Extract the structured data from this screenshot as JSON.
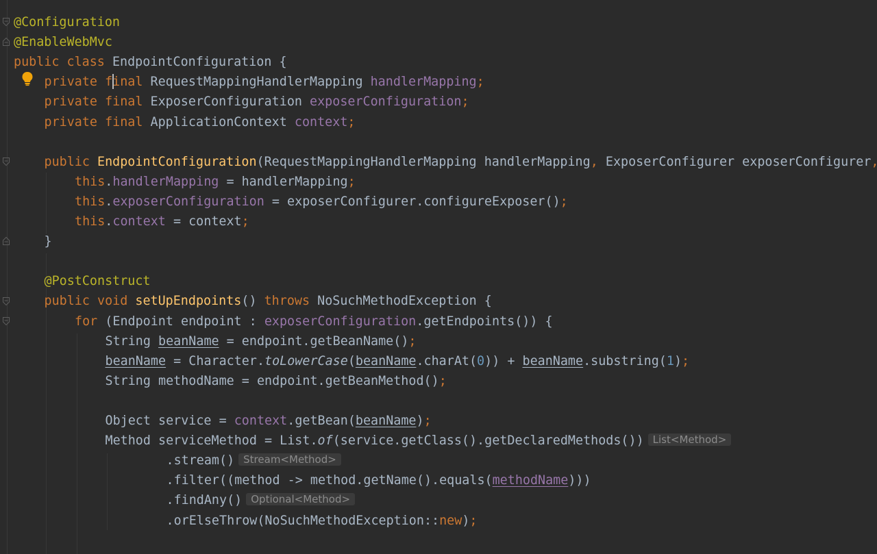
{
  "editor": {
    "lines": [
      {
        "indent": 0,
        "tokens": [
          {
            "t": "@Configuration",
            "c": "ann"
          }
        ]
      },
      {
        "indent": 0,
        "tokens": [
          {
            "t": "@EnableWebMvc",
            "c": "ann"
          }
        ]
      },
      {
        "indent": 0,
        "tokens": [
          {
            "t": "public class ",
            "c": "kw"
          },
          {
            "t": "EndpointConfiguration {",
            "c": "txt"
          }
        ]
      },
      {
        "indent": 1,
        "tokens": [
          {
            "t": "private final ",
            "c": "kw"
          },
          {
            "t": "RequestMappingHandlerMapping ",
            "c": "txt"
          },
          {
            "t": "handlerMapping",
            "c": "fld"
          },
          {
            "t": ";",
            "c": "kw"
          }
        ]
      },
      {
        "indent": 1,
        "tokens": [
          {
            "t": "private final ",
            "c": "kw"
          },
          {
            "t": "ExposerConfiguration ",
            "c": "txt"
          },
          {
            "t": "exposerConfiguration",
            "c": "fld"
          },
          {
            "t": ";",
            "c": "kw"
          }
        ]
      },
      {
        "indent": 1,
        "tokens": [
          {
            "t": "private final ",
            "c": "kw"
          },
          {
            "t": "ApplicationContext ",
            "c": "txt"
          },
          {
            "t": "context",
            "c": "fld"
          },
          {
            "t": ";",
            "c": "kw"
          }
        ]
      },
      {
        "indent": 0,
        "tokens": []
      },
      {
        "indent": 1,
        "tokens": [
          {
            "t": "public ",
            "c": "kw"
          },
          {
            "t": "EndpointConfiguration",
            "c": "fn"
          },
          {
            "t": "(RequestMappingHandlerMapping handlerMapping",
            "c": "txt"
          },
          {
            "t": ", ",
            "c": "kw"
          },
          {
            "t": "ExposerConfigurer exposerConfigurer",
            "c": "txt"
          },
          {
            "t": ",",
            "c": "kw"
          }
        ]
      },
      {
        "indent": 2,
        "tokens": [
          {
            "t": "this",
            "c": "kw"
          },
          {
            "t": ".",
            "c": "txt"
          },
          {
            "t": "handlerMapping",
            "c": "fld"
          },
          {
            "t": " = handlerMapping",
            "c": "txt"
          },
          {
            "t": ";",
            "c": "kw"
          }
        ]
      },
      {
        "indent": 2,
        "tokens": [
          {
            "t": "this",
            "c": "kw"
          },
          {
            "t": ".",
            "c": "txt"
          },
          {
            "t": "exposerConfiguration",
            "c": "fld"
          },
          {
            "t": " = exposerConfigurer.configureExposer()",
            "c": "txt"
          },
          {
            "t": ";",
            "c": "kw"
          }
        ]
      },
      {
        "indent": 2,
        "tokens": [
          {
            "t": "this",
            "c": "kw"
          },
          {
            "t": ".",
            "c": "txt"
          },
          {
            "t": "context",
            "c": "fld"
          },
          {
            "t": " = context",
            "c": "txt"
          },
          {
            "t": ";",
            "c": "kw"
          }
        ]
      },
      {
        "indent": 1,
        "tokens": [
          {
            "t": "}",
            "c": "txt"
          }
        ]
      },
      {
        "indent": 0,
        "tokens": []
      },
      {
        "indent": 1,
        "tokens": [
          {
            "t": "@PostConstruct",
            "c": "ann"
          }
        ]
      },
      {
        "indent": 1,
        "tokens": [
          {
            "t": "public void ",
            "c": "kw"
          },
          {
            "t": "setUpEndpoints",
            "c": "fn"
          },
          {
            "t": "() ",
            "c": "txt"
          },
          {
            "t": "throws ",
            "c": "kw"
          },
          {
            "t": "NoSuchMethodException {",
            "c": "txt"
          }
        ]
      },
      {
        "indent": 2,
        "tokens": [
          {
            "t": "for ",
            "c": "kw"
          },
          {
            "t": "(Endpoint endpoint : ",
            "c": "txt"
          },
          {
            "t": "exposerConfiguration",
            "c": "fld"
          },
          {
            "t": ".getEndpoints()) {",
            "c": "txt"
          }
        ]
      },
      {
        "indent": 3,
        "tokens": [
          {
            "t": "String ",
            "c": "txt"
          },
          {
            "t": "beanName",
            "c": "txtu"
          },
          {
            "t": " = endpoint.getBeanName()",
            "c": "txt"
          },
          {
            "t": ";",
            "c": "kw"
          }
        ]
      },
      {
        "indent": 3,
        "tokens": [
          {
            "t": "beanName",
            "c": "txtu"
          },
          {
            "t": " = Character.",
            "c": "txt"
          },
          {
            "t": "toLowerCase",
            "c": "ital"
          },
          {
            "t": "(",
            "c": "txt"
          },
          {
            "t": "beanName",
            "c": "txtu"
          },
          {
            "t": ".charAt(",
            "c": "txt"
          },
          {
            "t": "0",
            "c": "num"
          },
          {
            "t": ")) + ",
            "c": "txt"
          },
          {
            "t": "beanName",
            "c": "txtu"
          },
          {
            "t": ".substring(",
            "c": "txt"
          },
          {
            "t": "1",
            "c": "num"
          },
          {
            "t": ")",
            "c": "txt"
          },
          {
            "t": ";",
            "c": "kw"
          }
        ]
      },
      {
        "indent": 3,
        "tokens": [
          {
            "t": "String methodName = endpoint.getBeanMethod()",
            "c": "txt"
          },
          {
            "t": ";",
            "c": "kw"
          }
        ]
      },
      {
        "indent": 0,
        "tokens": []
      },
      {
        "indent": 3,
        "tokens": [
          {
            "t": "Object service = ",
            "c": "txt"
          },
          {
            "t": "context",
            "c": "fld"
          },
          {
            "t": ".getBean(",
            "c": "txt"
          },
          {
            "t": "beanName",
            "c": "txtu"
          },
          {
            "t": ")",
            "c": "txt"
          },
          {
            "t": ";",
            "c": "kw"
          }
        ]
      },
      {
        "indent": 3,
        "tokens": [
          {
            "t": "Method serviceMethod = List.",
            "c": "txt"
          },
          {
            "t": "of",
            "c": "ital"
          },
          {
            "t": "(service.getClass().getDeclaredMethods())",
            "c": "txt"
          },
          {
            "t": "List<Method>",
            "c": "hint"
          }
        ]
      },
      {
        "indent": 5,
        "tokens": [
          {
            "t": ".stream()",
            "c": "txt"
          },
          {
            "t": "Stream<Method>",
            "c": "hint"
          }
        ]
      },
      {
        "indent": 5,
        "tokens": [
          {
            "t": ".filter((method -> method.getName().equals(",
            "c": "txt"
          },
          {
            "t": "methodName",
            "c": "fldu"
          },
          {
            "t": ")))",
            "c": "txt"
          }
        ]
      },
      {
        "indent": 5,
        "tokens": [
          {
            "t": ".findAny()",
            "c": "txt"
          },
          {
            "t": "Optional<Method>",
            "c": "hint"
          }
        ]
      },
      {
        "indent": 5,
        "tokens": [
          {
            "t": ".orElseThrow(NoSuchMethodException::",
            "c": "txt"
          },
          {
            "t": "new",
            "c": "kw"
          },
          {
            "t": ")",
            "c": "txt"
          },
          {
            "t": ";",
            "c": "kw"
          }
        ]
      }
    ]
  },
  "colors": {
    "background": "#2b2b2b",
    "text": "#a9b7c6",
    "keyword": "#cc7832",
    "annotation": "#bbb529",
    "field": "#9876aa",
    "method_declaration": "#ffc66d",
    "number": "#6897bb"
  },
  "icons": {
    "bulb": "intention-bulb-icon",
    "fold": "fold-marker-icon"
  }
}
